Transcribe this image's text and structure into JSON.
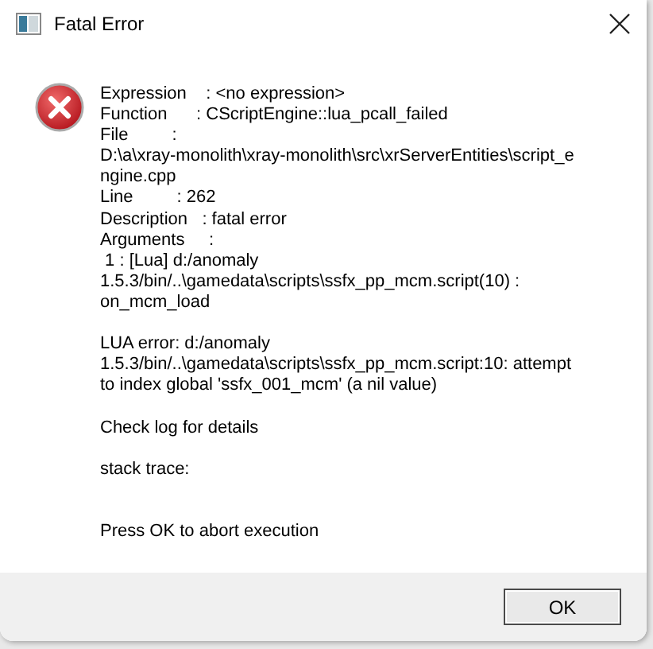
{
  "window": {
    "title": "Fatal Error"
  },
  "message": "Expression    : <no expression>\nFunction      : CScriptEngine::lua_pcall_failed\nFile         :\nD:\\a\\xray-monolith\\xray-monolith\\src\\xrServerEntities\\script_e\nngine.cpp\nLine         : 262\nDescription   : fatal error\nArguments     :\n 1 : [Lua] d:/anomaly\n1.5.3/bin/..\\gamedata\\scripts\\ssfx_pp_mcm.script(10) :\non_mcm_load\n\nLUA error: d:/anomaly\n1.5.3/bin/..\\gamedata\\scripts\\ssfx_pp_mcm.script:10: attempt\nto index global 'ssfx_001_mcm' (a nil value)\n\nCheck log for details\n\nstack trace:\n\n\nPress OK to abort execution",
  "buttons": [
    {
      "label": "OK",
      "kind": "default"
    }
  ]
}
